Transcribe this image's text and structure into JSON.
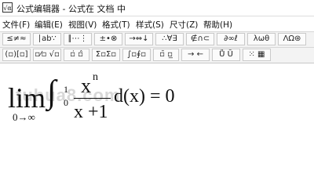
{
  "window": {
    "title": "公式编辑器 - 公式在 文档 中",
    "icon": "equation-editor-icon"
  },
  "menu": [
    {
      "label": "文件(F)"
    },
    {
      "label": "编辑(E)"
    },
    {
      "label": "视图(V)"
    },
    {
      "label": "格式(T)"
    },
    {
      "label": "样式(S)"
    },
    {
      "label": "尺寸(Z)"
    },
    {
      "label": "帮助(H)"
    }
  ],
  "toolbar": {
    "row1": [
      {
        "label": "≤≠≈",
        "name": "relations-palette-button"
      },
      {
        "label": "∣ab∵",
        "name": "spaces-ellipses-palette-button"
      },
      {
        "label": "∥⋯⋮",
        "name": "embellishments-palette-button"
      },
      {
        "label": "±•⊗",
        "name": "operators-palette-button"
      },
      {
        "label": "→⇔↓",
        "name": "arrows-palette-button"
      },
      {
        "label": "∴∀∃",
        "name": "logic-palette-button"
      },
      {
        "label": "∉∩⊂",
        "name": "set-theory-palette-button"
      },
      {
        "label": "∂∞ℓ",
        "name": "misc-symbols-palette-button"
      },
      {
        "label": "λωθ",
        "name": "greek-lowercase-palette-button"
      },
      {
        "label": "ΛΩ⊛",
        "name": "greek-uppercase-palette-button"
      }
    ],
    "row2": [
      {
        "label": "(▫)[▫]",
        "name": "fences-palette-button"
      },
      {
        "label": "▫⁄▫ √▫",
        "name": "fractions-radicals-palette-button"
      },
      {
        "label": "▫̇ ▫̂",
        "name": "scripts-palette-button"
      },
      {
        "label": "Σ▫Σ▫",
        "name": "summations-palette-button"
      },
      {
        "label": "∫▫∮▫",
        "name": "integrals-palette-button"
      },
      {
        "label": "▫̄ ▫̲",
        "name": "underbars-overbars-palette-button"
      },
      {
        "label": "→ ←",
        "name": "labeled-arrows-palette-button"
      },
      {
        "label": "Ů Ṻ",
        "name": "products-palette-button"
      },
      {
        "label": "⁙ ▦",
        "name": "matrices-palette-button"
      }
    ]
  },
  "watermark": "tuhua8.com",
  "equation": {
    "lim": "lim",
    "lim_sub": "0→∞",
    "integral": "∫",
    "upper": "1",
    "lower": "0",
    "numerator_base": "x",
    "numerator_exp": "n",
    "denominator": "x +1",
    "differential": "d(x) = 0"
  }
}
